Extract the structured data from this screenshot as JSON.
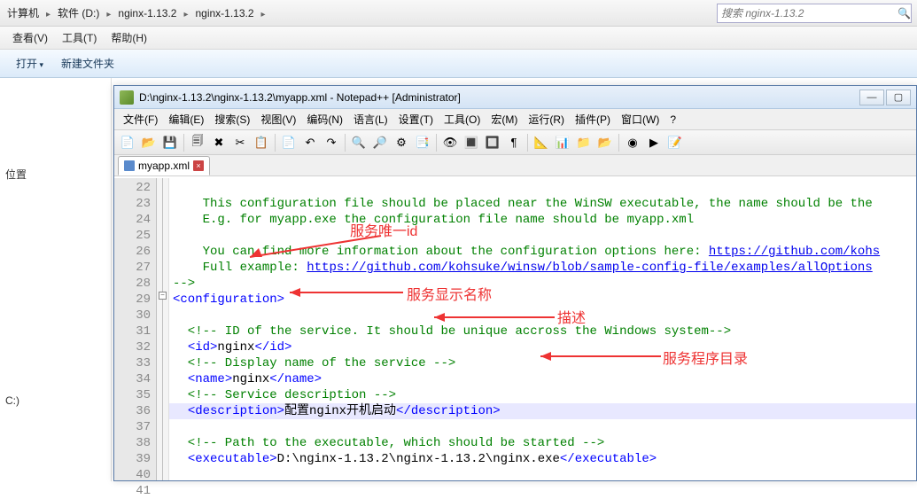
{
  "explorer": {
    "breadcrumb": [
      "计算机",
      "软件 (D:)",
      "nginx-1.13.2",
      "nginx-1.13.2"
    ],
    "search_placeholder": "搜索 nginx-1.13.2",
    "menu": [
      "查看(V)",
      "工具(T)",
      "帮助(H)"
    ],
    "toolbar": [
      "打开",
      "新建文件夹"
    ],
    "sidebar_label": "位置",
    "sidebar_label2": "C:)"
  },
  "npp": {
    "title": "D:\\nginx-1.13.2\\nginx-1.13.2\\myapp.xml - Notepad++ [Administrator]",
    "menu": [
      "文件(F)",
      "编辑(E)",
      "搜索(S)",
      "视图(V)",
      "编码(N)",
      "语言(L)",
      "设置(T)",
      "工具(O)",
      "宏(M)",
      "运行(R)",
      "插件(P)",
      "窗口(W)",
      "?"
    ],
    "tab_label": "myapp.xml",
    "close_x": "×"
  },
  "code": {
    "line_start": 22,
    "lines": [
      "",
      "    This configuration file should be placed near the WinSW executable, the name should be the ",
      "    E.g. for myapp.exe the configuration file name should be myapp.xml",
      "",
      "    You can find more information about the configuration options here: https://github.com/kohs",
      "    Full example: https://github.com/kohsuke/winsw/blob/sample-config-file/examples/allOptions",
      "-->",
      "<configuration>",
      "",
      "  <!-- ID of the service. It should be unique accross the Windows system-->",
      "  <id>nginx</id>",
      "  <!-- Display name of the service -->",
      "  <name>nginx</name>",
      "  <!-- Service description -->",
      "  <description>配置nginx开机启动</description>",
      "",
      "  <!-- Path to the executable, which should be started -->",
      "  <executable>D:\\nginx-1.13.2\\nginx-1.13.2\\nginx.exe</executable>",
      "",
      ""
    ]
  },
  "annotations": {
    "a1": "服务唯一id",
    "a2": "服务显示名称",
    "a3": "描述",
    "a4": "服务程序目录"
  },
  "toolbar_icons": [
    "📄",
    "📂",
    "💾",
    "🗐",
    "✖",
    "✂",
    "📋",
    "📄",
    "↶",
    "↷",
    "🔍",
    "🔎",
    "⚙",
    "📑",
    "👁",
    "🔳",
    "🔲",
    "¶",
    "📐",
    "📊",
    "📁",
    "📂",
    "◉",
    "▶",
    "📝"
  ]
}
